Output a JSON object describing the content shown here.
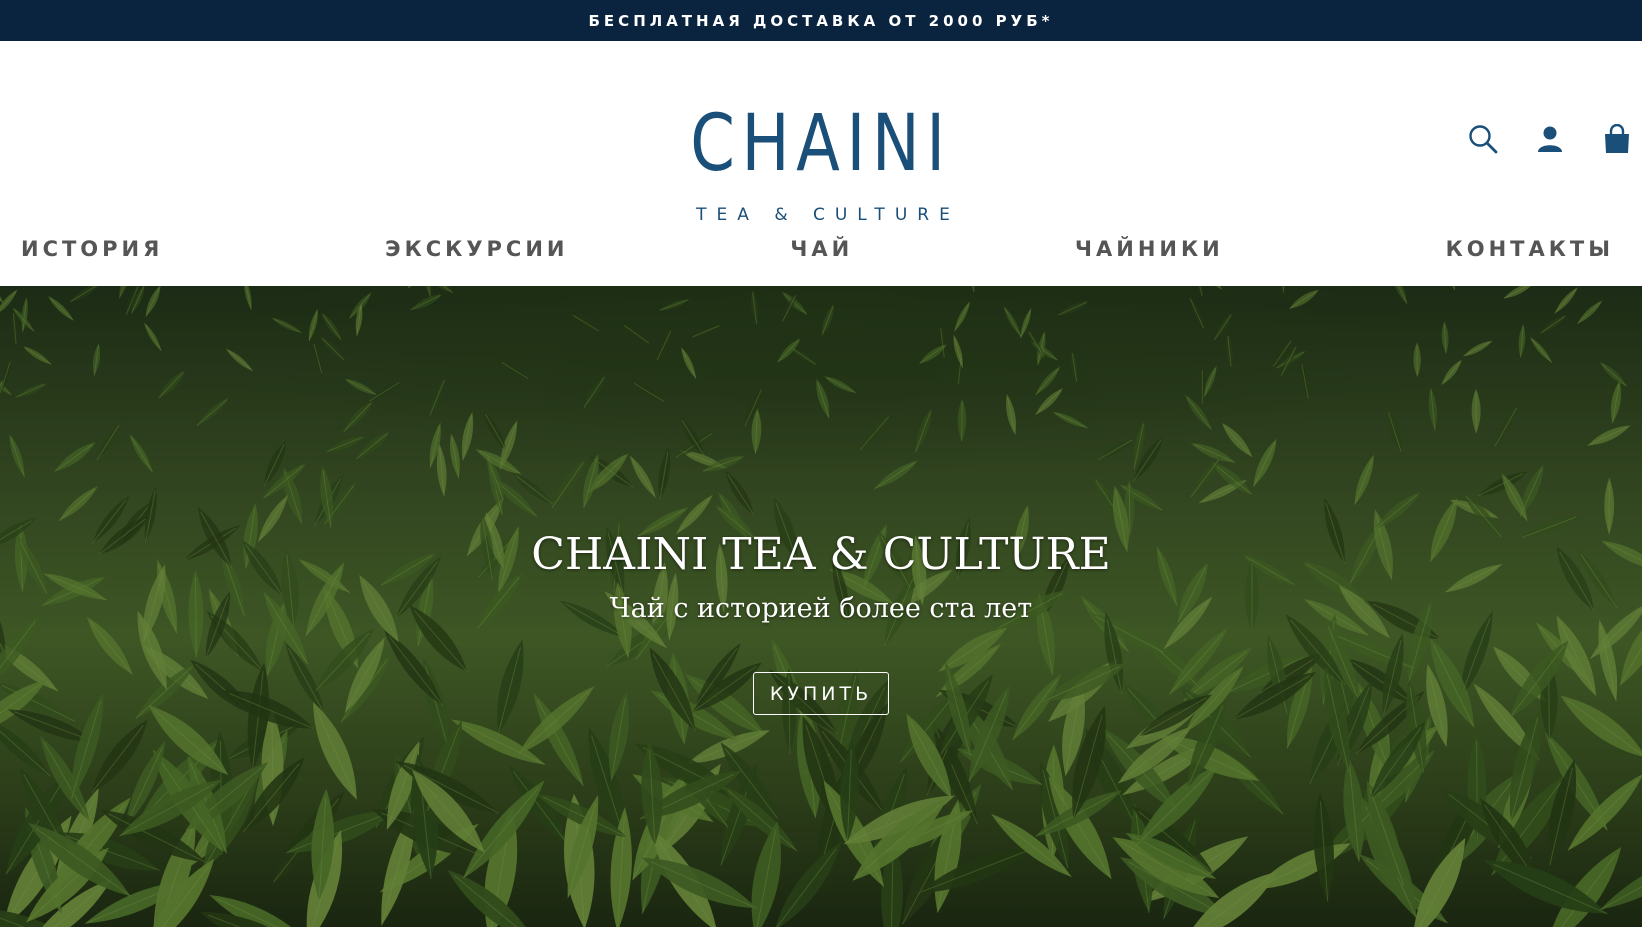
{
  "announcement": {
    "text": "БЕСПЛАТНАЯ ДОСТАВКА ОТ 2000 РУБ*"
  },
  "brand": {
    "name": "CHAINI",
    "tagline": "TEA & CULTURE",
    "color": "#1a4f79"
  },
  "header_icons": [
    "search-icon",
    "account-icon",
    "cart-icon"
  ],
  "nav": {
    "items": [
      {
        "label": "ИСТОРИЯ"
      },
      {
        "label": "ЭКСКУРСИИ"
      },
      {
        "label": "ЧАЙ"
      },
      {
        "label": "ЧАЙНИКИ"
      },
      {
        "label": "КОНТАКТЫ"
      }
    ]
  },
  "hero": {
    "title": "CHAINI TEA & CULTURE",
    "subtitle": "Чай с историей более ста лет",
    "button_label": "КУПИТЬ"
  },
  "colors": {
    "topbar": "#0a2440",
    "nav_text": "#555555",
    "hero_green": "#4d6a2e"
  }
}
